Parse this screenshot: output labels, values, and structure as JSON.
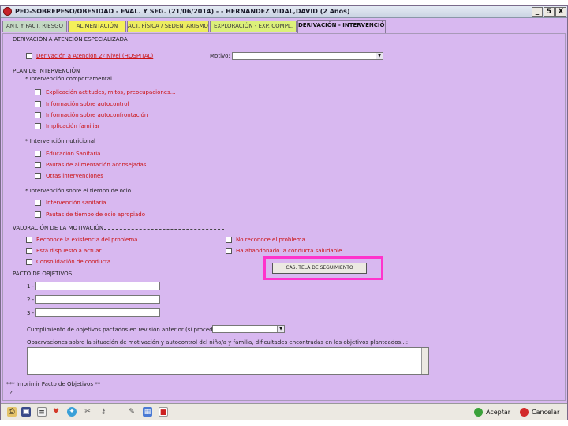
{
  "window": {
    "title": "PED-SOBREPESO/OBESIDAD - EVAL. Y SEG. (21/06/2014) - - HERNANDEZ VIDAL,DAVID (2 Años)",
    "min_label": "_",
    "max_label": "5",
    "close_label": "X"
  },
  "tabs": [
    {
      "label": "ANT. Y FACT. RIESGO"
    },
    {
      "label": "ALIMENTACIÓN"
    },
    {
      "label": "ACT. FÍSICA / SEDENTARISMO"
    },
    {
      "label": "EXPLORACIÓN - EXP. COMPL."
    },
    {
      "label": "DERIVACIÓN - INTERVENCIÓN"
    }
  ],
  "derivacion": {
    "header": "DERIVACIÓN A ATENCIÓN ESPECIALIZADA",
    "option": "Derivación a Atención 2º Nivel (HOSPITAL)",
    "motivo_label": "Motivo:",
    "motivo_value": ""
  },
  "plan": {
    "header": "PLAN DE INTERVENCIÓN",
    "comportamental": {
      "title": "* Intervención comportamental",
      "items": [
        "Explicación actitudes, mitos, preocupaciones...",
        "Información sobre autocontrol",
        "Información sobre autoconfrontación",
        "Implicación familiar"
      ]
    },
    "nutricional": {
      "title": "* Intervención nutricional",
      "items": [
        "Educación Sanitaria",
        "Pautas de alimentación aconsejadas",
        "Otras intervenciones"
      ]
    },
    "tiempo_libre": {
      "title": "* Intervención sobre el tiempo de ocio",
      "items": [
        "Intervención sanitaria",
        "Pautas de tiempo de ocio apropiado"
      ]
    }
  },
  "motivacion": {
    "header": "VALORACIÓN DE LA MOTIVACIÓN",
    "left": [
      "Reconoce la existencia del problema",
      "Está dispuesto a actuar",
      "Consolidación de conducta"
    ],
    "right": [
      "No reconoce el problema",
      "Ha abandonado la conducta saludable"
    ]
  },
  "pacto": {
    "header": "PACTO DE OBJETIVOS",
    "rows": [
      "1 -",
      "2 -",
      "3 -"
    ],
    "values": [
      "",
      "",
      ""
    ],
    "seguimiento_button": "CAS. TELA DE SEGUIMIENTO"
  },
  "cumplimiento": {
    "label": "Cumplimiento de objetivos pactados en revisión anterior (si procede)",
    "value": ""
  },
  "observaciones": {
    "label": "Observaciones sobre la situación de motivación y autocontrol del niño/a y familia, dificultades encontradas en los objetivos planteados...:",
    "value": ""
  },
  "footer_notes": {
    "line1": "*** Imprimir Pacto de Objetivos **",
    "line2": "?"
  },
  "toolbar": {
    "icons": [
      "printer-icon",
      "save-icon",
      "document-icon",
      "heart-icon",
      "network-icon",
      "tools-icon",
      "key-icon",
      "ruler-icon",
      "calendar-icon",
      "flag-icon"
    ],
    "accept_label": "Aceptar",
    "cancel_label": "Cancelar"
  },
  "colors": {
    "panel_bg": "#d8b8f0",
    "required_text": "#cc1111",
    "highlight": "#ff33cc"
  }
}
